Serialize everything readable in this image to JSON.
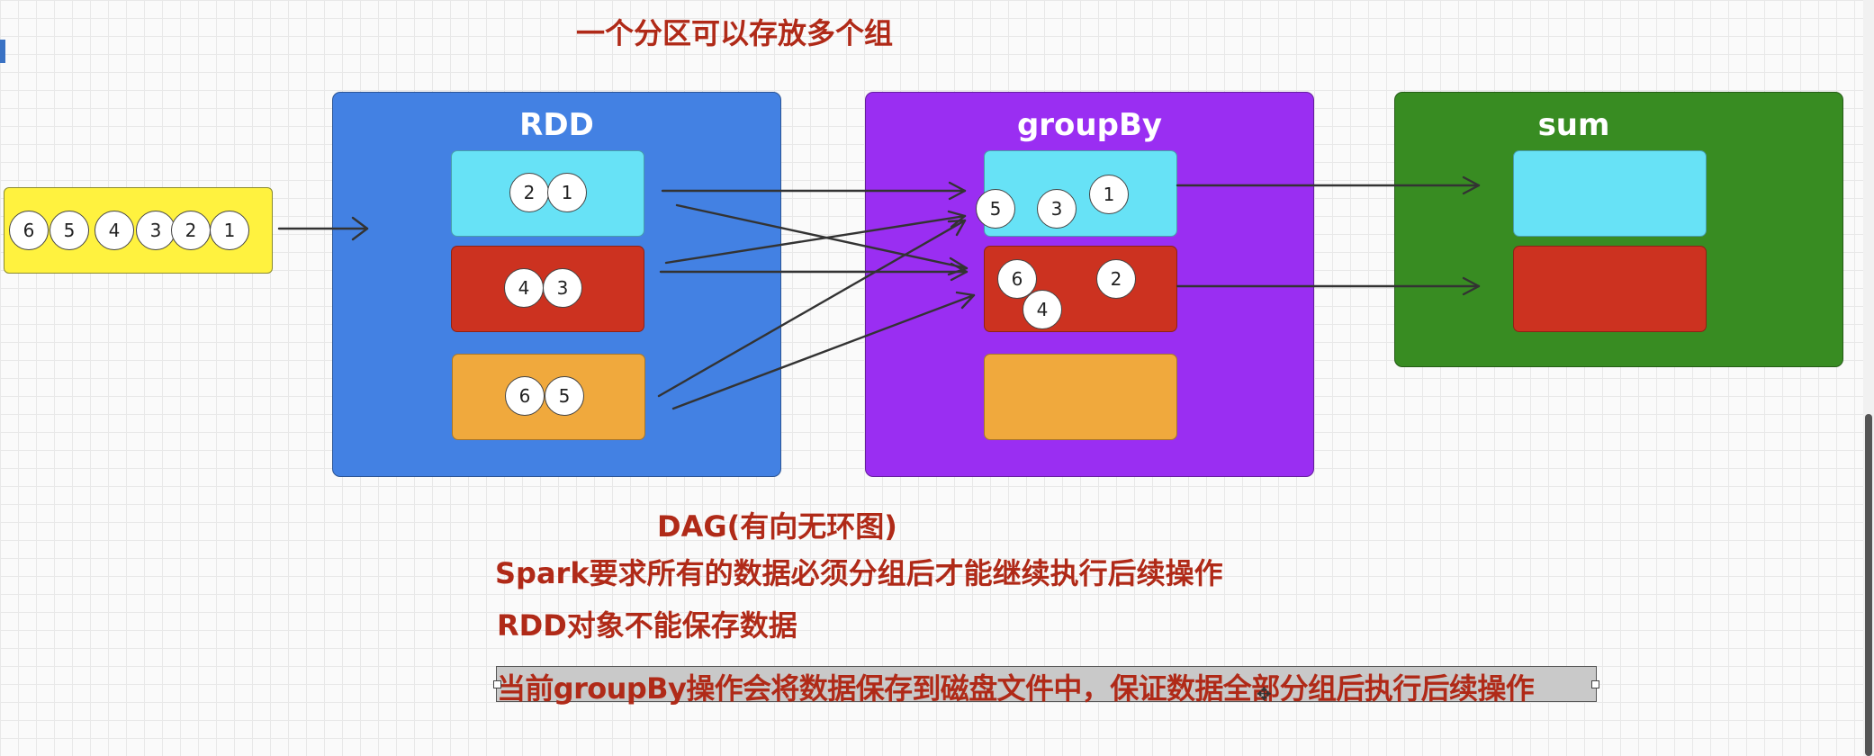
{
  "header_note": "一个分区可以存放多个组",
  "source": {
    "items": [
      "6",
      "5",
      "4",
      "3",
      "2",
      "1"
    ]
  },
  "rdd": {
    "title": "RDD",
    "partitions": [
      {
        "color": "#67e2f6",
        "items": [
          "2",
          "1"
        ]
      },
      {
        "color": "#cc3220",
        "items": [
          "4",
          "3"
        ]
      },
      {
        "color": "#f0a93d",
        "items": [
          "6",
          "5"
        ]
      }
    ]
  },
  "groupby": {
    "title": "groupBy",
    "partitions": [
      {
        "color": "#67e2f6",
        "items": [
          "5",
          "3",
          "1"
        ]
      },
      {
        "color": "#cc3220",
        "items": [
          "6",
          "4",
          "2"
        ]
      },
      {
        "color": "#f0a93d",
        "items": []
      }
    ]
  },
  "sum": {
    "title": "sum",
    "partitions": [
      {
        "color": "#67e2f6"
      },
      {
        "color": "#cc3220"
      }
    ]
  },
  "colors": {
    "source_bg": "#fff23f",
    "rdd_bg": "#4381e3",
    "groupby_bg": "#9a2ef2",
    "sum_bg": "#388c22",
    "note_red": "#b02a18"
  },
  "notes": [
    "DAG(有向无环图)",
    "Spark要求所有的数据必须分组后才能继续执行后续操作",
    "RDD对象不能保存数据",
    "当前groupBy操作会将数据保存到磁盘文件中，保证数据全部分组后执行后续操作"
  ]
}
